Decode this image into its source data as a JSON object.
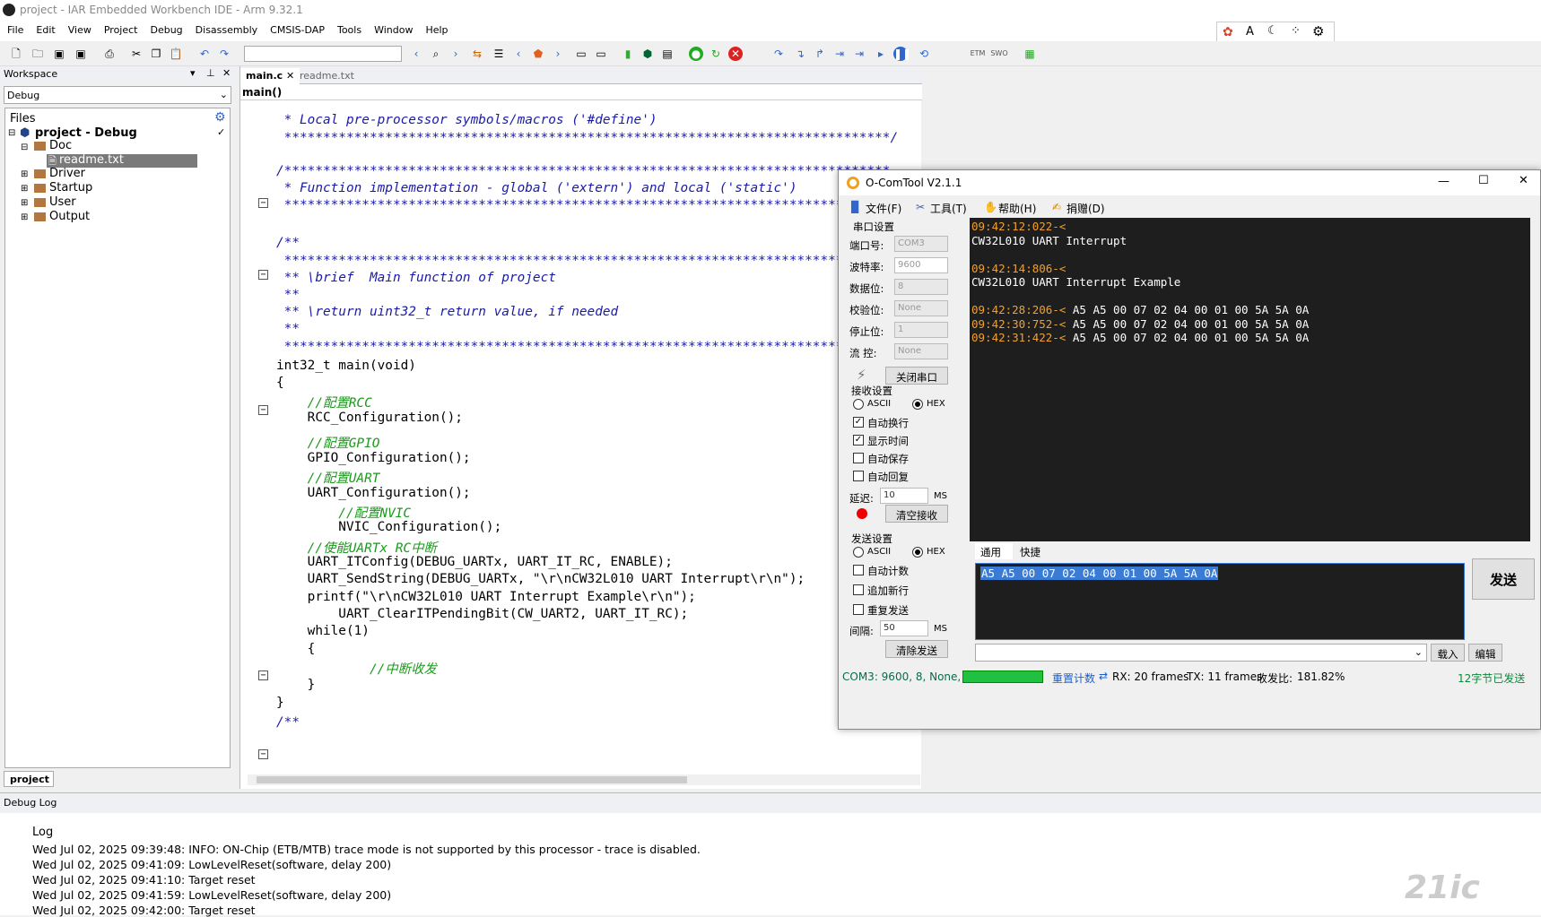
{
  "ide": {
    "title": "project - IAR Embedded Workbench IDE - Arm 9.32.1",
    "menu": [
      "File",
      "Edit",
      "View",
      "Project",
      "Debug",
      "Disassembly",
      "CMSIS-DAP",
      "Tools",
      "Window",
      "Help"
    ],
    "toolbar_labels": {
      "etm": "ETM",
      "swo": "SWO"
    }
  },
  "workspace": {
    "header": "Workspace",
    "config": "Debug",
    "files_label": "Files",
    "project": "project - Debug",
    "doc": "Doc",
    "readme": "readme.txt",
    "driver": "Driver",
    "startup": "Startup",
    "user": "User",
    "output": "Output",
    "bottom_tab": "project"
  },
  "editor": {
    "tabs": [
      "main.c",
      "readme.txt"
    ],
    "func_dropdown": "main()"
  },
  "code": [
    {
      "c": "cm",
      "t": " * Local pre-processor symbols/macros ('#define')"
    },
    {
      "c": "cm",
      "t": " ******************************************************************************/"
    },
    {
      "c": "cm",
      "t": "/******************************************************************************"
    },
    {
      "c": "cm",
      "t": " * Function implementation - global ('extern') and local ('static')"
    },
    {
      "c": "cm",
      "t": " ******************************************************************************"
    },
    {
      "c": "cm",
      "t": "/**"
    },
    {
      "c": "cm",
      "t": " ******************************************************************************"
    },
    {
      "c": "cm",
      "t": " ** \\brief  Main function of project"
    },
    {
      "c": "cm",
      "t": " **"
    },
    {
      "c": "cm",
      "t": " ** \\return uint32_t return value, if needed"
    },
    {
      "c": "cm",
      "t": " **"
    },
    {
      "c": "cm",
      "t": " ******************************************************************************"
    },
    {
      "c": "n",
      "t": "int32_t main(void)"
    },
    {
      "c": "n",
      "t": "{"
    },
    {
      "c": "cg",
      "t": "    //配置RCC"
    },
    {
      "c": "n",
      "t": "    RCC_Configuration();"
    },
    {
      "c": "cg",
      "t": "    //配置GPIO"
    },
    {
      "c": "n",
      "t": "    GPIO_Configuration();"
    },
    {
      "c": "cg",
      "t": "    //配置UART"
    },
    {
      "c": "n",
      "t": "    UART_Configuration();"
    },
    {
      "c": "cg",
      "t": "        //配置NVIC"
    },
    {
      "c": "n",
      "t": "        NVIC_Configuration();"
    },
    {
      "c": "cg",
      "t": "    //使能UARTx RC中断"
    },
    {
      "c": "n",
      "t": "    UART_ITConfig(DEBUG_UARTx, UART_IT_RC, ENABLE);"
    },
    {
      "c": "n",
      "t": "    UART_SendString(DEBUG_UARTx, \"\\r\\nCW32L010 UART Interrupt\\r\\n\");"
    },
    {
      "c": "n",
      "t": "    printf(\"\\r\\nCW32L010 UART Interrupt Example\\r\\n\");"
    },
    {
      "c": "n",
      "t": "        UART_ClearITPendingBit(CW_UART2, UART_IT_RC);"
    },
    {
      "c": "n",
      "t": "    while(1)"
    },
    {
      "c": "n",
      "t": "    {"
    },
    {
      "c": "cg",
      "t": "            //中断收发"
    },
    {
      "c": "n",
      "t": "    }"
    },
    {
      "c": "n",
      "t": "}"
    },
    {
      "c": "cm",
      "t": "/**"
    }
  ],
  "debuglog": {
    "header": "Debug Log",
    "col": "Log",
    "lines": [
      "Wed Jul 02, 2025 09:39:48: INFO: ON-Chip (ETB/MTB) trace mode is not supported by this processor - trace is disabled.",
      "Wed Jul 02, 2025 09:41:09: LowLevelReset(software, delay 200)",
      "Wed Jul 02, 2025 09:41:10: Target reset",
      "Wed Jul 02, 2025 09:41:59: LowLevelReset(software, delay 200)",
      "Wed Jul 02, 2025 09:42:00: Target reset"
    ]
  },
  "comtool": {
    "title": "O-ComTool V2.1.1",
    "menu": [
      "文件(F)",
      "工具(T)",
      "帮助(H)",
      "捐赠(D)"
    ],
    "serial": {
      "group": "串口设置",
      "port_l": "端口号:",
      "port": "COM3",
      "baud_l": "波特率:",
      "baud": "9600",
      "data_l": "数据位:",
      "data": "8",
      "parity_l": "校验位:",
      "parity": "None",
      "stop_l": "停止位:",
      "stop": "1",
      "flow_l": "流  控:",
      "flow": "None",
      "close_btn": "关闭串口"
    },
    "recvset": {
      "group": "接收设置",
      "ascii": "ASCII",
      "hex": "HEX",
      "autowrap": "自动换行",
      "showtime": "显示时间",
      "autosave": "自动保存",
      "autoreply": "自动回复",
      "delay_l": "延迟:",
      "delay": "10",
      "ms": "MS",
      "clear": "清空接收"
    },
    "sendset": {
      "group": "发送设置",
      "ascii": "ASCII",
      "hex": "HEX",
      "autocount": "自动计数",
      "newline": "追加新行",
      "repeat": "重复发送",
      "interval_l": "间隔:",
      "interval": "50",
      "ms": "MS",
      "clear": "清除发送"
    },
    "recv": [
      {
        "ts": "09:42:12:022-<",
        "data": ""
      },
      {
        "ts": "",
        "data": "CW32L010 UART Interrupt"
      },
      {
        "ts": "",
        "data": ""
      },
      {
        "ts": "09:42:14:806-<",
        "data": ""
      },
      {
        "ts": "",
        "data": "CW32L010 UART Interrupt Example"
      },
      {
        "ts": "",
        "data": ""
      },
      {
        "ts": "09:42:28:206-<",
        "data": " A5 A5 00 07 02 04 00 01 00 5A 5A 0A"
      },
      {
        "ts": "09:42:30:752-<",
        "data": " A5 A5 00 07 02 04 00 01 00 5A 5A 0A"
      },
      {
        "ts": "09:42:31:422-<",
        "data": " A5 A5 00 07 02 04 00 01 00 5A 5A 0A"
      }
    ],
    "tabs": [
      "通用",
      "快捷"
    ],
    "send_text": "A5 A5 00 07 02 04 00 01 00 5A 5A 0A",
    "send_btn": "发送",
    "load_btn": "载入",
    "edit_btn": "编辑",
    "status": {
      "port": "COM3: 9600, 8, None, 1",
      "reset": "重置计数",
      "rx": "RX: 20 frames",
      "tx": "TX: 11 frames",
      "ratio": "收发比:",
      "ratio_v": "181.82%",
      "bytes": "12字节已发送"
    }
  },
  "colors": {
    "accent": "#3a7bd5",
    "timestamp": "#f0a030",
    "comment": "#1a1aa8",
    "green_comment": "#1b9a1b",
    "string": "#cc0000"
  }
}
